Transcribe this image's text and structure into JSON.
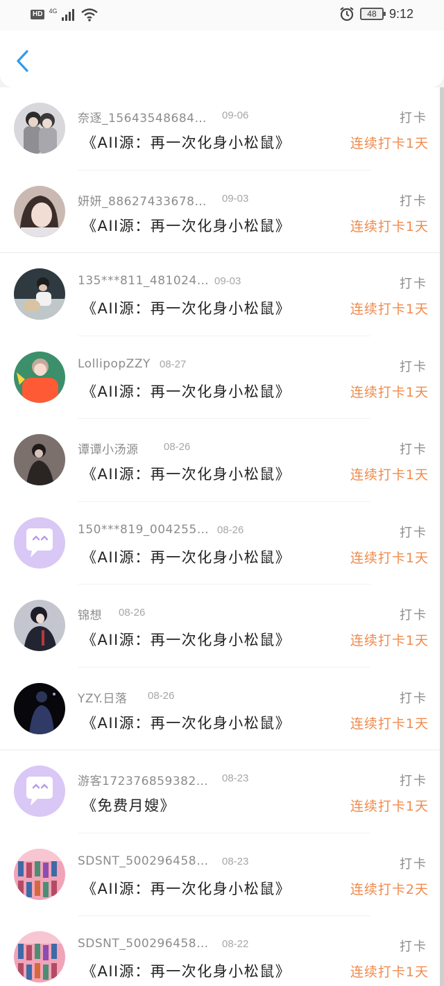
{
  "status_bar": {
    "hd": "HD",
    "network": "4G",
    "battery": "48",
    "time": "9:12"
  },
  "header": {
    "back_icon": "chevron-left-icon",
    "accent_color": "#2f9bea"
  },
  "colors": {
    "streak": "#f08a4b",
    "meta": "#8c8c8c",
    "placeholder_avatar": "#d9c7f5"
  },
  "records": [
    {
      "user": "奈逐_15643548684…",
      "date": "09-06",
      "book": "《AII源：再一次化身小松鼠》",
      "action": "打卡",
      "streak": "连续打卡1天",
      "avatar": "photo-duo"
    },
    {
      "user": "妍妍_886274336788…",
      "date": "09-03",
      "book": "《AII源：再一次化身小松鼠》",
      "action": "打卡",
      "streak": "连续打卡1天",
      "avatar": "photo-girl"
    },
    {
      "user": "135***811_4810240892",
      "date": "09-03",
      "book": "《AII源：再一次化身小松鼠》",
      "action": "打卡",
      "streak": "连续打卡1天",
      "avatar": "photo-dog"
    },
    {
      "user": "LollipopZZY",
      "date": "08-27",
      "book": "《AII源：再一次化身小松鼠》",
      "action": "打卡",
      "streak": "连续打卡1天",
      "avatar": "photo-red"
    },
    {
      "user": "谭谭小汤源",
      "date": "08-26",
      "book": "《AII源：再一次化身小松鼠》",
      "action": "打卡",
      "streak": "连续打卡1天",
      "avatar": "photo-dark"
    },
    {
      "user": "150***819_0042558569",
      "date": "08-26",
      "book": "《AII源：再一次化身小松鼠》",
      "action": "打卡",
      "streak": "连续打卡1天",
      "avatar": "placeholder"
    },
    {
      "user": "锦想",
      "date": "08-26",
      "book": "《AII源：再一次化身小松鼠》",
      "action": "打卡",
      "streak": "连续打卡1天",
      "avatar": "photo-figure"
    },
    {
      "user": "YZY.日落",
      "date": "08-26",
      "book": "《AII源：再一次化身小松鼠》",
      "action": "打卡",
      "streak": "连续打卡1天",
      "avatar": "photo-night"
    },
    {
      "user": "游客172376859382…",
      "date": "08-23",
      "book": "《免费月嫂》",
      "action": "打卡",
      "streak": "连续打卡1天",
      "avatar": "placeholder"
    },
    {
      "user": "SDSNT_5002964587…",
      "date": "08-23",
      "book": "《AII源：再一次化身小松鼠》",
      "action": "打卡",
      "streak": "连续打卡2天",
      "avatar": "photo-pink"
    },
    {
      "user": "SDSNT_5002964587…",
      "date": "08-22",
      "book": "《AII源：再一次化身小松鼠》",
      "action": "打卡",
      "streak": "连续打卡1天",
      "avatar": "photo-pink"
    }
  ]
}
